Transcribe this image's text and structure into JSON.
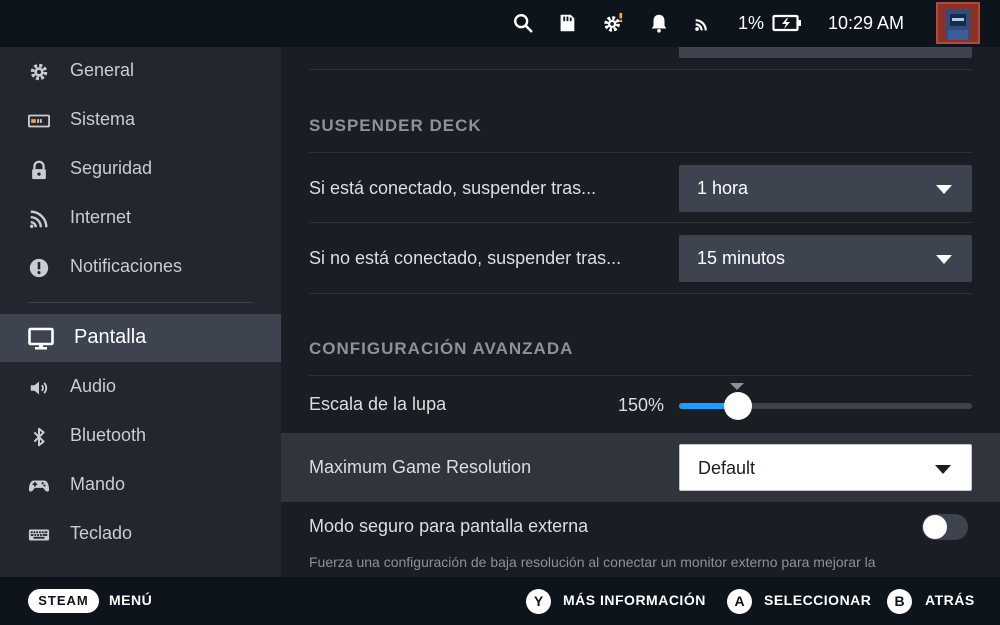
{
  "status_bar": {
    "battery_percent": "1%",
    "time": "10:29 AM",
    "icons": [
      "search-icon",
      "storage-icon",
      "gear-alert-icon",
      "bell-icon",
      "cast-icon",
      "battery-charging-icon",
      "avatar"
    ]
  },
  "sidebar": {
    "items": [
      {
        "label": "General",
        "icon": "gear-icon"
      },
      {
        "label": "Sistema",
        "icon": "system-icon"
      },
      {
        "label": "Seguridad",
        "icon": "lock-icon"
      },
      {
        "label": "Internet",
        "icon": "wifi-icon"
      },
      {
        "label": "Notificaciones",
        "icon": "alert-icon"
      },
      {
        "label": "Pantalla",
        "icon": "monitor-icon",
        "active": true
      },
      {
        "label": "Audio",
        "icon": "speaker-icon"
      },
      {
        "label": "Bluetooth",
        "icon": "bluetooth-icon"
      },
      {
        "label": "Mando",
        "icon": "gamepad-icon"
      },
      {
        "label": "Teclado",
        "icon": "keyboard-icon"
      }
    ]
  },
  "main": {
    "suspend": {
      "title": "SUSPENDER DECK",
      "connected_label": "Si está conectado, suspender tras...",
      "connected_value": "1 hora",
      "disconnected_label": "Si no está conectado, suspender tras...",
      "disconnected_value": "15 minutos"
    },
    "advanced": {
      "title": "CONFIGURACIÓN AVANZADA",
      "magnifier_label": "Escala de la lupa",
      "magnifier_value": "150%",
      "magnifier_fraction": 0.2,
      "resolution_label": "Maximum Game Resolution",
      "resolution_value": "Default",
      "safe_mode_label": "Modo seguro para pantalla externa",
      "safe_mode_on": false,
      "safe_mode_desc": "Fuerza una configuración de baja resolución al conectar un monitor externo para mejorar la compatibilidad"
    }
  },
  "bottom_bar": {
    "steam_label": "STEAM",
    "menu_label": "MENÚ",
    "y_button": "Y",
    "y_label": "MÁS INFORMACIÓN",
    "a_button": "A",
    "a_label": "SELECCIONAR",
    "b_button": "B",
    "b_label": "ATRÁS"
  },
  "colors": {
    "accent": "#1a9fff",
    "sidebar_bg": "#23262e",
    "active_bg": "#3d4450",
    "main_bg": "#1a1d23",
    "bar_bg": "#0e141b"
  }
}
